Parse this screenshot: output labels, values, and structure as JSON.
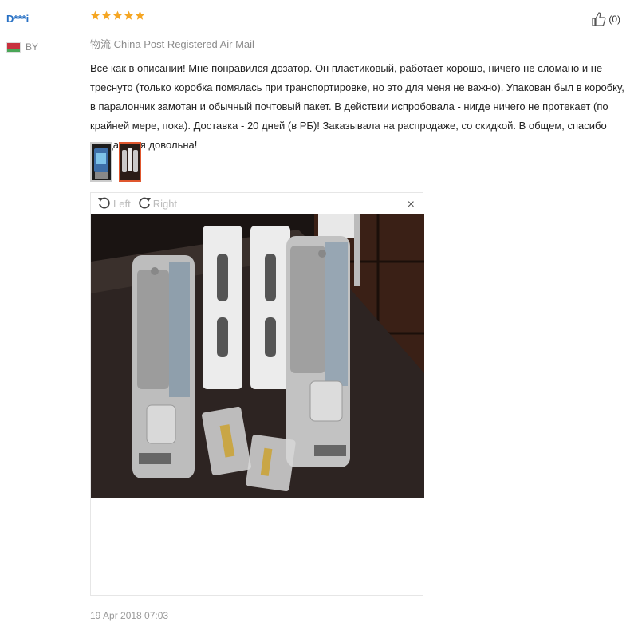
{
  "review": {
    "user_name": "D***i",
    "country": "BY",
    "rating": 5,
    "helpful_count": "(0)",
    "shipping": "物流 China Post Registered Air Mail",
    "text": "Всё как в описании! Мне понравился дозатор. Он пластиковый, работает хорошо, ничего не сломано и не треснуто (только коробка помялась при транспортировке, но это для меня не важно). Упакован был в коробку, в паралончик замотан и обычный почтовый пакет. В действии испробовала - нигде ничего не протекает (по крайней мере, пока). Доставка - 20 дней (в РБ)! Заказывала на распродаже, со скидкой. В общем, спасибо продавцу, я довольна!",
    "date": "19 Apr 2018 07:03"
  },
  "viewer": {
    "rotate_left": "Left",
    "rotate_right": "Right",
    "close": "×"
  },
  "icons": {
    "star": "star-icon",
    "thumb_up": "thumbs-up-icon",
    "rotate_left": "rotate-left-icon",
    "rotate_right": "rotate-right-icon"
  },
  "colors": {
    "star": "#f5a623",
    "user_link": "#2770c4",
    "active_thumb": "#e0572e"
  }
}
